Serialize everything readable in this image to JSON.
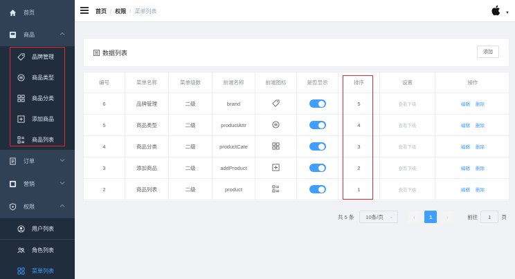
{
  "sidebar": {
    "home": "首页",
    "product": "商品",
    "product_items": [
      "品牌管理",
      "商品类型",
      "商品分类",
      "添加商品",
      "商品列表"
    ],
    "order": "订单",
    "marketing": "营销",
    "permission": "权限",
    "permission_items": [
      "用户列表",
      "角色列表",
      "菜单列表"
    ]
  },
  "header": {
    "crumb1": "首页",
    "crumb2": "权限",
    "crumb3": "菜单列表",
    "sep": "/"
  },
  "card": {
    "title": "数据列表",
    "add_label": "添加"
  },
  "table": {
    "columns": [
      "编号",
      "菜单名称",
      "菜单级数",
      "前端名称",
      "前端图标",
      "是否显示",
      "排序",
      "设置",
      "操作"
    ],
    "rows": [
      {
        "id": "6",
        "name": "品牌管理",
        "level": "二级",
        "frontname": "brand",
        "icon": "tag-icon",
        "show": true,
        "sort": "5",
        "setting": "查看下级",
        "edit": "编辑",
        "del": "删除"
      },
      {
        "id": "5",
        "name": "商品类型",
        "level": "二级",
        "frontname": "productAttr",
        "icon": "circle-list-icon",
        "show": true,
        "sort": "4",
        "setting": "查看下级",
        "edit": "编辑",
        "del": "删除"
      },
      {
        "id": "4",
        "name": "商品分类",
        "level": "二级",
        "frontname": "productCate",
        "icon": "grid-icon",
        "show": true,
        "sort": "3",
        "setting": "查看下级",
        "edit": "编辑",
        "del": "删除"
      },
      {
        "id": "3",
        "name": "添加商品",
        "level": "二级",
        "frontname": "addProduct",
        "icon": "plus-square-icon",
        "show": true,
        "sort": "2",
        "setting": "查看下级",
        "edit": "编辑",
        "del": "删除"
      },
      {
        "id": "2",
        "name": "商品列表",
        "level": "二级",
        "frontname": "product",
        "icon": "list-grid-icon",
        "show": true,
        "sort": "1",
        "setting": "查看下级",
        "edit": "编辑",
        "del": "删除"
      }
    ]
  },
  "pager": {
    "total": "共 5 条",
    "size": "10条/页",
    "current": "1",
    "goto": "前往",
    "goto_value": "1",
    "page_unit": "页"
  },
  "colors": {
    "sidebar_bg": "#304156",
    "accent": "#409eff",
    "highlight": "#e0282f"
  }
}
